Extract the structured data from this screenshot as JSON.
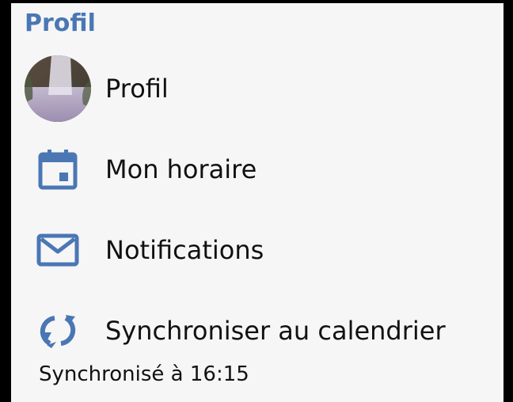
{
  "section": {
    "title": "Profil"
  },
  "menu": {
    "items": [
      {
        "label": "Profil",
        "icon": "avatar-image"
      },
      {
        "label": "Mon horaire",
        "icon": "calendar-icon"
      },
      {
        "label": "Notifications",
        "icon": "mail-icon"
      },
      {
        "label": "Synchroniser au calendrier",
        "icon": "sync-icon"
      }
    ]
  },
  "sync": {
    "status": "Synchronisé à 16:15"
  },
  "colors": {
    "accent": "#4a77b4",
    "background": "#f6f6f6",
    "text": "#111111"
  }
}
